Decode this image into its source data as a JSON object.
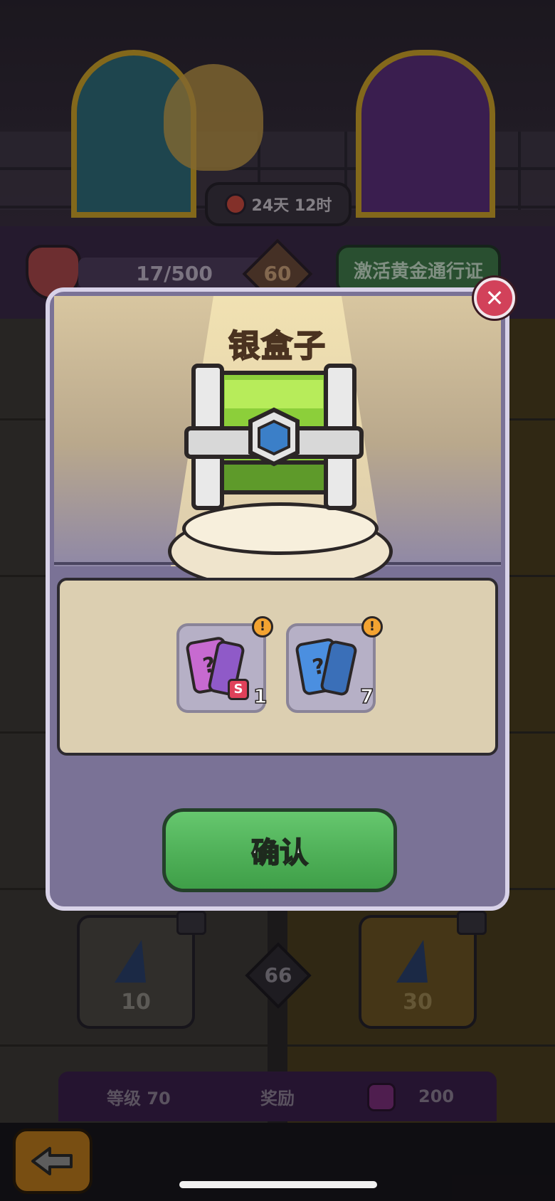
{
  "header": {
    "timer_text": "24天 12时",
    "progress_text": "17/500",
    "tier_level": "60",
    "gold_pass_label": "激活黄金通行证"
  },
  "track": {
    "level_marker": "66",
    "left_reward_value": "10",
    "right_reward_value": "30"
  },
  "bottom_bar": {
    "level_label": "等级 70",
    "reward_label": "奖励",
    "reward_amount": "200"
  },
  "modal": {
    "title": "银盒子",
    "items": [
      {
        "icon": "purple-mystery-card-icon",
        "badge": "S",
        "count": "1"
      },
      {
        "icon": "blue-mystery-card-icon",
        "count": "7"
      }
    ],
    "alert_symbol": "!",
    "confirm_label": "确认",
    "close_symbol": "✕"
  },
  "colors": {
    "confirm_green": "#4fb058",
    "close_red": "#d2415a",
    "alert_orange": "#f3a331",
    "modal_frame": "#7a7296"
  }
}
